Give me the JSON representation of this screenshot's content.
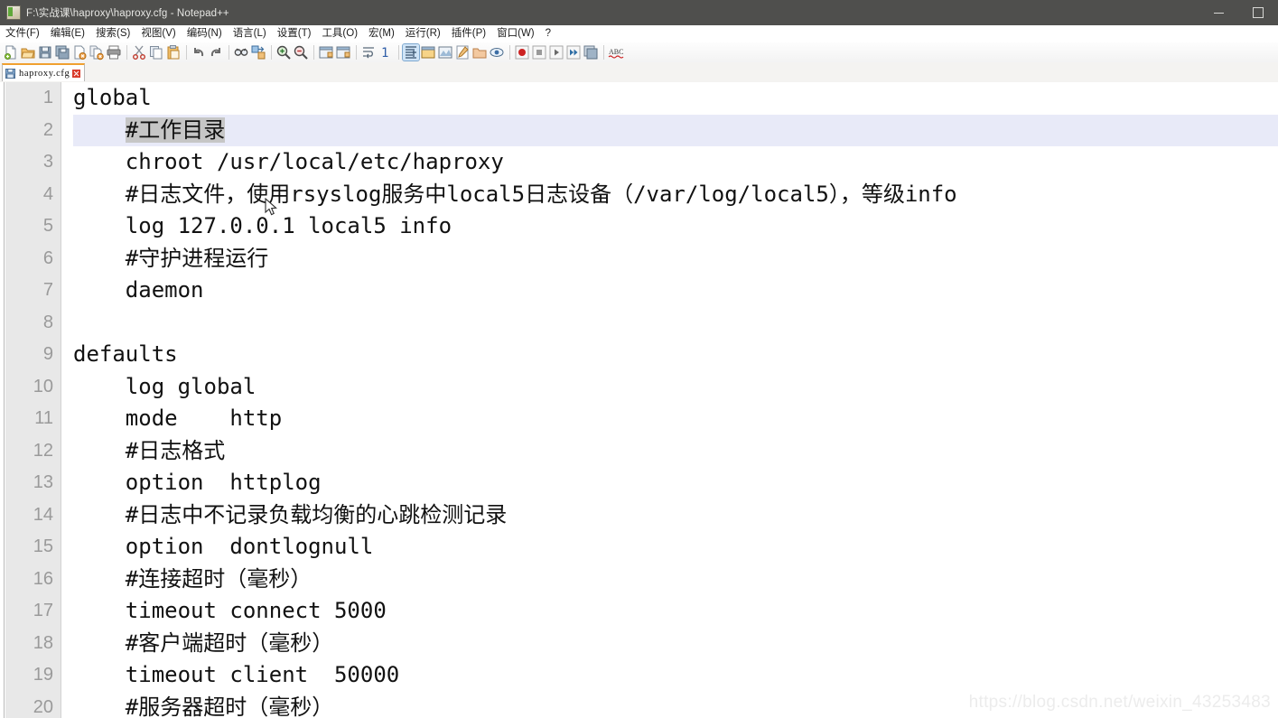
{
  "window": {
    "title": "F:\\实战课\\haproxy\\haproxy.cfg - Notepad++",
    "app_icon": "notepad-plus-plus-icon",
    "minimize_label": "–",
    "maximize_label": "□"
  },
  "menubar": {
    "items": [
      {
        "label": "文件(F)",
        "name": "menu-file"
      },
      {
        "label": "编辑(E)",
        "name": "menu-edit"
      },
      {
        "label": "搜索(S)",
        "name": "menu-search"
      },
      {
        "label": "视图(V)",
        "name": "menu-view"
      },
      {
        "label": "编码(N)",
        "name": "menu-encoding"
      },
      {
        "label": "语言(L)",
        "name": "menu-language"
      },
      {
        "label": "设置(T)",
        "name": "menu-settings"
      },
      {
        "label": "工具(O)",
        "name": "menu-tools"
      },
      {
        "label": "宏(M)",
        "name": "menu-macro"
      },
      {
        "label": "运行(R)",
        "name": "menu-run"
      },
      {
        "label": "插件(P)",
        "name": "menu-plugins"
      },
      {
        "label": "窗口(W)",
        "name": "menu-window"
      },
      {
        "label": "?",
        "name": "menu-help"
      }
    ]
  },
  "toolbar": {
    "items": [
      "new-file-icon",
      "open-file-icon",
      "save-icon",
      "save-all-icon",
      "close-file-icon",
      "close-all-icon",
      "print-icon",
      "sep",
      "cut-icon",
      "copy-icon",
      "paste-icon",
      "sep",
      "undo-icon",
      "redo-icon",
      "sep",
      "find-icon",
      "replace-icon",
      "sep",
      "zoom-in-icon",
      "zoom-out-icon",
      "sep",
      "sync-vertical-scroll-icon",
      "sync-horizontal-scroll-icon",
      "sep",
      "word-wrap-icon",
      "show-all-chars-icon",
      "sep",
      "indent-guide-icon",
      "user-defined-dialog-icon",
      "show-document-map-icon",
      "show-function-list-icon",
      "show-folder-panel-icon",
      "monitoring-icon",
      "sep",
      "record-macro-icon",
      "stop-macro-icon",
      "play-macro-icon",
      "run-macro-multiple-icon",
      "save-macro-icon",
      "sep",
      "spell-check-icon"
    ]
  },
  "tabbar": {
    "tabs": [
      {
        "label": "haproxy.cfg",
        "icon": "save-blue-icon",
        "close_icon": "close-tab-icon",
        "active": true
      }
    ]
  },
  "editor": {
    "current_line": 2,
    "selection": {
      "line": 2,
      "text": "#工作目录"
    },
    "lines": [
      {
        "n": "1",
        "text": "global"
      },
      {
        "n": "2",
        "text": "    #工作目录",
        "selected": true
      },
      {
        "n": "3",
        "text": "    chroot /usr/local/etc/haproxy"
      },
      {
        "n": "4",
        "text": "    #日志文件，使用rsyslog服务中local5日志设备（/var/log/local5），等级info"
      },
      {
        "n": "5",
        "text": "    log 127.0.0.1 local5 info"
      },
      {
        "n": "6",
        "text": "    #守护进程运行"
      },
      {
        "n": "7",
        "text": "    daemon"
      },
      {
        "n": "8",
        "text": ""
      },
      {
        "n": "9",
        "text": "defaults"
      },
      {
        "n": "10",
        "text": "    log global"
      },
      {
        "n": "11",
        "text": "    mode    http"
      },
      {
        "n": "12",
        "text": "    #日志格式"
      },
      {
        "n": "13",
        "text": "    option  httplog"
      },
      {
        "n": "14",
        "text": "    #日志中不记录负载均衡的心跳检测记录"
      },
      {
        "n": "15",
        "text": "    option  dontlognull"
      },
      {
        "n": "16",
        "text": "    #连接超时（毫秒）"
      },
      {
        "n": "17",
        "text": "    timeout connect 5000"
      },
      {
        "n": "18",
        "text": "    #客户端超时（毫秒）"
      },
      {
        "n": "19",
        "text": "    timeout client  50000"
      },
      {
        "n": "20",
        "text": "    #服务器超时（毫秒）"
      }
    ]
  },
  "watermark": {
    "text": "https://blog.csdn.net/weixin_43253483"
  },
  "colors": {
    "titlebar_bg": "#4f4f4d",
    "gutter_bg": "#e8e8e8",
    "current_line_bg": "#e8eaf8",
    "selection_bg": "#c6c6c6",
    "tab_accent": "#f0a030",
    "editor_text": "#111111"
  }
}
